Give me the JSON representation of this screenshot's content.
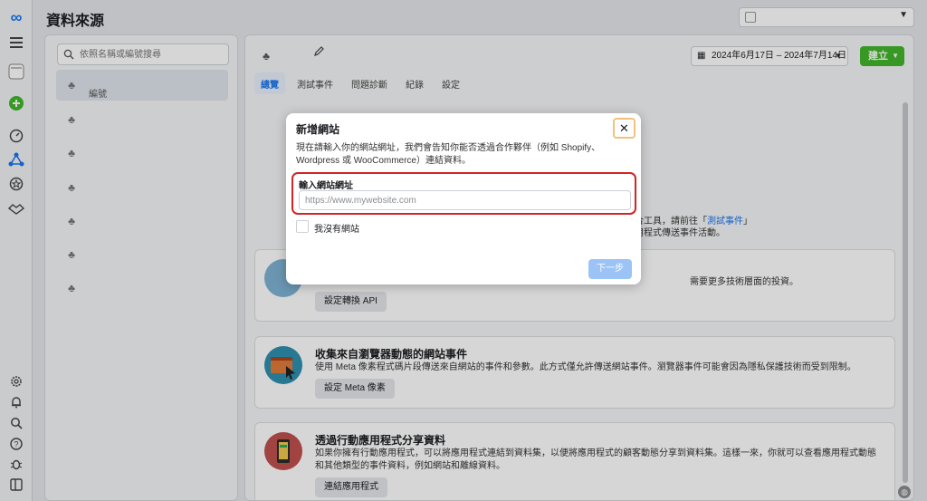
{
  "header": {
    "page_title": "資料來源"
  },
  "rail": {
    "icons": [
      "meta-logo-icon",
      "menu-icon",
      "account-icon",
      "add-icon",
      "dashboard-icon",
      "data-sources-icon",
      "star-icon",
      "partner-icon",
      "settings-icon",
      "notifications-icon",
      "search-icon",
      "help-icon",
      "debug-icon",
      "panel-icon"
    ],
    "meta_logo": "∞"
  },
  "left_panel": {
    "search_placeholder": "依照名稱或編號搜尋",
    "items": [
      {
        "label": "編號",
        "selected": true
      },
      {
        "label": "",
        "selected": false
      },
      {
        "label": "",
        "selected": false
      },
      {
        "label": "",
        "selected": false
      },
      {
        "label": "",
        "selected": false
      },
      {
        "label": "",
        "selected": false
      },
      {
        "label": "",
        "selected": false
      }
    ]
  },
  "main": {
    "date_range": "2024年6月17日 – 2024年7月14日",
    "create_label": "建立",
    "tabs": [
      "總覽",
      "測試事件",
      "問題診斷",
      "紀錄",
      "設定"
    ],
    "active_tab": 0,
    "side_text_1_pre": "合工具，請前往「",
    "side_text_1_link": "測試事件",
    "side_text_1_post": "」",
    "side_text_2": "用程式傳送事件活動。",
    "cards": [
      {
        "title": "",
        "desc": "需要更多技術層面的投資。",
        "button": "設定轉換 API"
      },
      {
        "title": "收集來自瀏覽器動態的網站事件",
        "desc": "使用 Meta 像素程式碼片段傳送來自網站的事件和參數。此方式僅允許傳送網站事件。瀏覽器事件可能會因為隱私保護技術而受到限制。",
        "button": "設定 Meta 像素"
      },
      {
        "title": "透過行動應用程式分享資料",
        "desc": "如果你擁有行動應用程式，可以將應用程式連結到資料集，以便將應用程式的顧客動態分享到資料集。這樣一來，你就可以查看應用程式動態和其他類型的事件資料，例如網站和離線資料。",
        "button": "連結應用程式"
      }
    ]
  },
  "modal": {
    "title": "新增網站",
    "close_symbol": "✕",
    "description": "現在請輸入你的網站網址，我們會告知你能否透過合作夥伴（例如 Shopify、Wordpress 或 WooCommerce）連結資料。",
    "url_label": "輸入網站網址",
    "url_placeholder": "https://www.mywebsite.com",
    "url_value": "",
    "no_website_label": "我沒有網站",
    "no_website_checked": false,
    "next_label": "下一步"
  },
  "colors": {
    "accent": "#1877f2",
    "create_green": "#42b72a",
    "highlight_red": "#d12424",
    "next_disabled": "#9cc3f5"
  }
}
